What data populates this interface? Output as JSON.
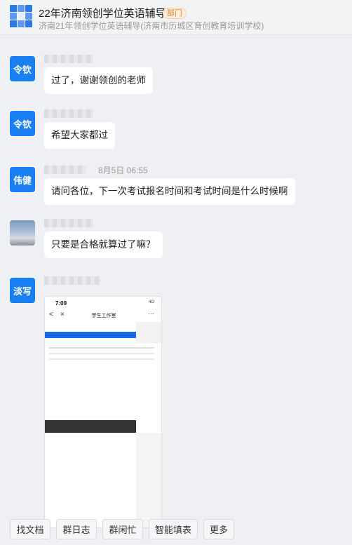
{
  "header": {
    "title": "22年济南领创学位英语辅导",
    "badge": "部门",
    "subtitle": "济南21年领创学位英语辅导(济南市历城区育创教育培训学校)"
  },
  "messages": [
    {
      "avatar_text": "令钦",
      "text": "过了，谢谢领创的老师"
    },
    {
      "avatar_text": "令钦",
      "text": "希望大家都过"
    },
    {
      "avatar_text": "伟健",
      "time": "8月5日 06:55",
      "text": "请问各位，下一次考试报名时间和考试时间是什么时候啊"
    },
    {
      "avatar_text": "",
      "text": "只要是合格就算过了嘛？"
    },
    {
      "avatar_text": "淡写"
    }
  ],
  "screenshot": {
    "status_time": "7:09",
    "signal": "4G",
    "nav_title": "学生工作室",
    "back_glyph": "<",
    "close_glyph": "×",
    "more_glyph": "···"
  },
  "bottom_buttons": [
    "找文档",
    "群日志",
    "群闲忙",
    "智能填表",
    "更多"
  ]
}
